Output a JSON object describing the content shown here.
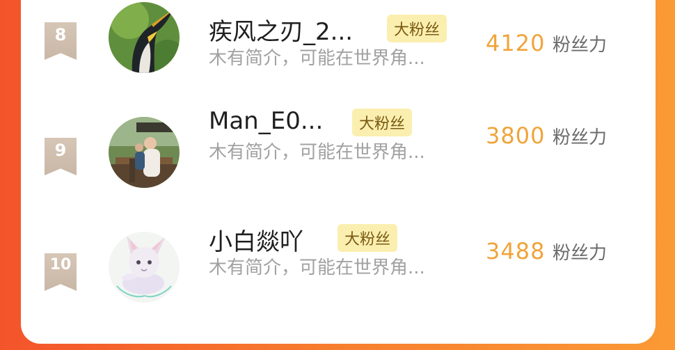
{
  "list": [
    {
      "rank": "8",
      "name": "疾风之刃_2...",
      "badge": "大粉丝",
      "intro": "木有简介，可能在世界角...",
      "score": "4120",
      "unit": "粉丝力",
      "avatar": "penguin-avatar"
    },
    {
      "rank": "9",
      "name": "Man_E0...",
      "badge": "大粉丝",
      "intro": "木有简介，可能在世界角...",
      "score": "3800",
      "unit": "粉丝力",
      "avatar": "family-photo-avatar"
    },
    {
      "rank": "10",
      "name": "小白燚吖",
      "badge": "大粉丝",
      "intro": "木有简介，可能在世界角...",
      "score": "3488",
      "unit": "粉丝力",
      "avatar": "cartoon-creature-avatar"
    }
  ],
  "colors": {
    "background_left": "#f4542b",
    "background_right": "#fb9a35",
    "score": "#f0a43a",
    "badge_bg": "#fbefb0",
    "rank_ribbon": "#d6c6b6"
  }
}
